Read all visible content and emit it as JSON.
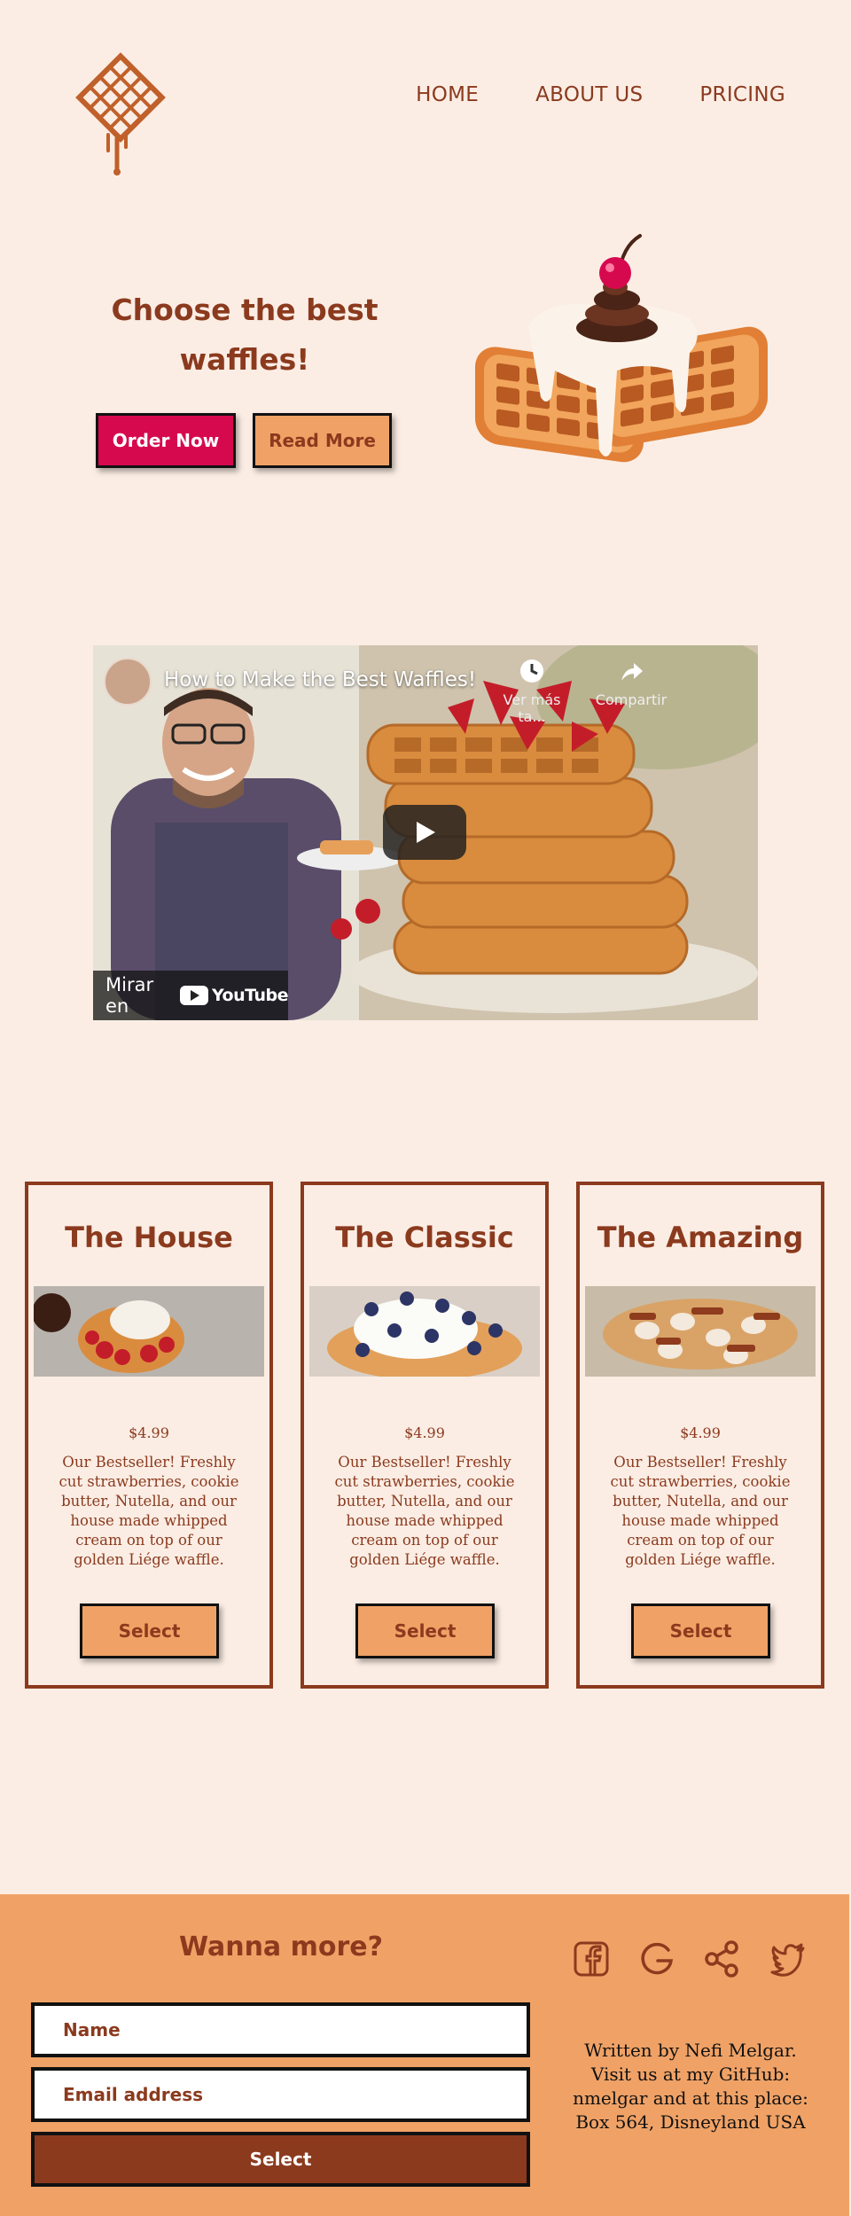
{
  "nav": {
    "items": [
      "HOME",
      "ABOUT US",
      "PRICING"
    ]
  },
  "hero": {
    "title": "Choose the best waffles!",
    "order_label": "Order Now",
    "read_label": "Read More"
  },
  "video": {
    "title": "How to Make the Best Waffles!",
    "watch_later": "Ver más ta...",
    "share": "Compartir",
    "watch_on": "Mirar en",
    "youtube": "YouTube"
  },
  "cards": [
    {
      "title": "The House",
      "price": "$4.99",
      "description": "Our Bestseller! Freshly cut strawberries, cookie butter, Nutella, and our house made whipped cream on top of our golden Liége waffle.",
      "button": "Select"
    },
    {
      "title": "The Classic",
      "price": "$4.99",
      "description": "Our Bestseller! Freshly cut strawberries, cookie butter, Nutella, and our house made whipped cream on top of our golden Liége waffle.",
      "button": "Select"
    },
    {
      "title": "The Amazing",
      "price": "$4.99",
      "description": "Our Bestseller! Freshly cut strawberries, cookie butter, Nutella, and our house made whipped cream on top of our golden Liége waffle.",
      "button": "Select"
    }
  ],
  "footer": {
    "title": "Wanna more?",
    "name_placeholder": "Name",
    "email_placeholder": "Email address",
    "select_label": "Select",
    "info": "Written by Nefi Melgar. Visit us at my GitHub: nmelgar and at this place: Box 564, Disneyland USA"
  },
  "social_icons": [
    "facebook-icon",
    "google-icon",
    "share-icon",
    "twitter-icon"
  ],
  "colors": {
    "background": "#fbede4",
    "brand_brown": "#8b3a1e",
    "accent_orange": "#f0a266",
    "accent_pink": "#d6094f"
  }
}
